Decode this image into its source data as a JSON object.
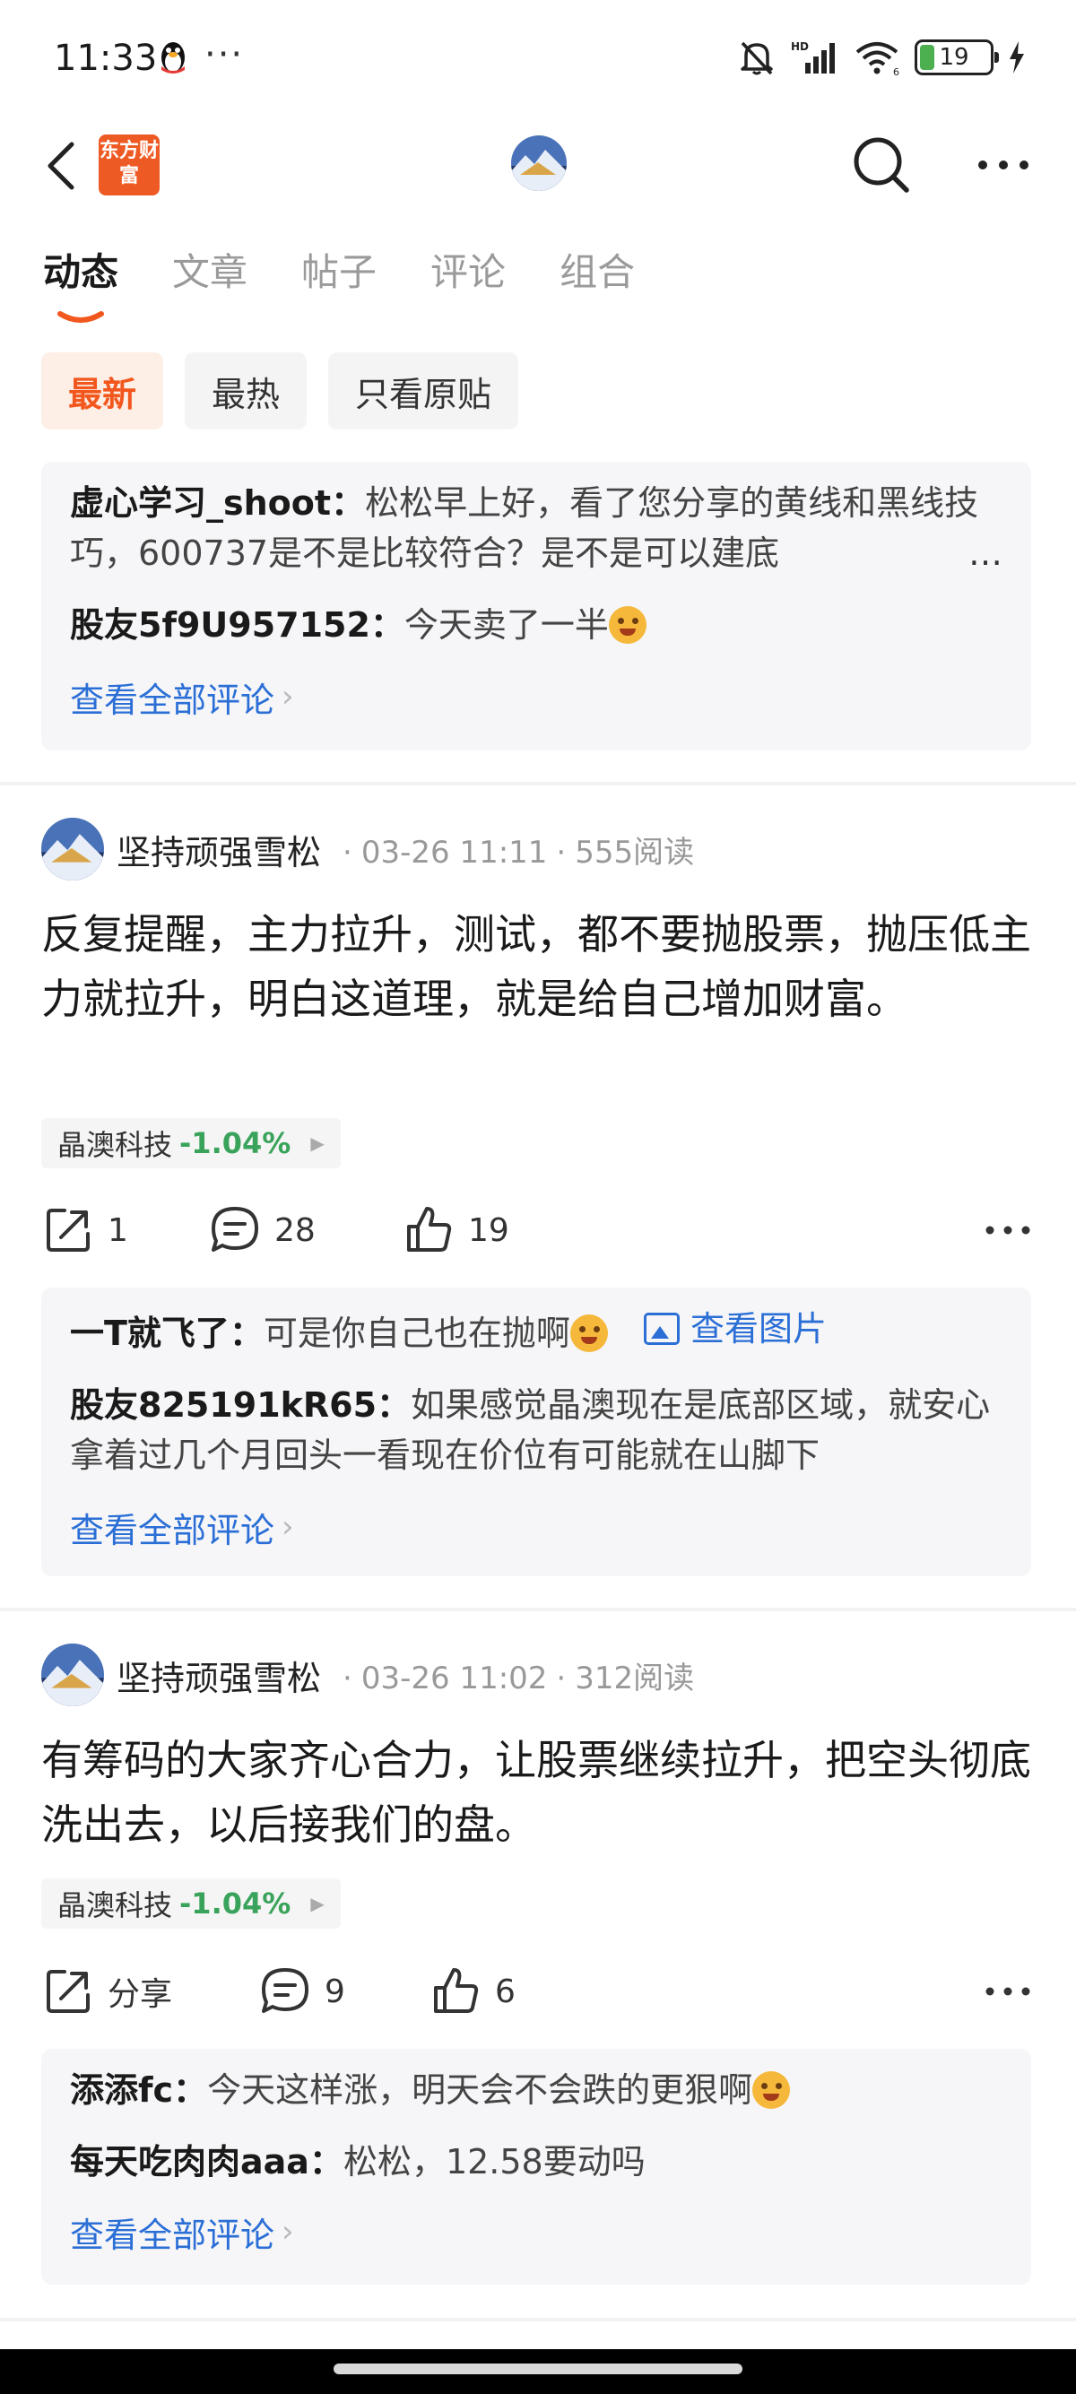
{
  "status_bar": {
    "time": "11:33",
    "dots": "···",
    "battery": "19"
  },
  "nav": {
    "logo_text": "东方财富"
  },
  "tabs": [
    "动态",
    "文章",
    "帖子",
    "评论",
    "组合"
  ],
  "filters": [
    "最新",
    "最热",
    "只看原贴"
  ],
  "top_comments": {
    "items": [
      {
        "author": "虚心学习_shoot：",
        "text": "松松早上好，看了您分享的黄线和黑线技巧，600737是不是比较符合？是不是可以建底"
      },
      {
        "author": "股友5f9U957152：",
        "text": "今天卖了一半"
      }
    ],
    "ellipsis": "…",
    "view_all": "查看全部评论"
  },
  "posts": [
    {
      "author": "坚持顽强雪松",
      "date": "03-26 11:11",
      "reads": "555阅读",
      "body": "反复提醒，主力拉升，测试，都不要抛股票，抛压低主力就拉升，明白这道理，就是给自己增加财富。",
      "stock": {
        "name": "晶澳科技",
        "change": "-1.04%"
      },
      "actions": {
        "share": "1",
        "comments": "28",
        "likes": "19"
      },
      "comments": [
        {
          "author": "一T就飞了：",
          "text": "可是你自己也在抛啊",
          "image_link": "查看图片"
        },
        {
          "author": "股友825191kR65：",
          "text": "如果感觉晶澳现在是底部区域，就安心拿着过几个月回头一看现在价位有可能就在山脚下"
        }
      ],
      "view_all": "查看全部评论"
    },
    {
      "author": "坚持顽强雪松",
      "date": "03-26 11:02",
      "reads": "312阅读",
      "body": "有筹码的大家齐心合力，让股票继续拉升，把空头彻底洗出去，以后接我们的盘。",
      "stock": {
        "name": "晶澳科技",
        "change": "-1.04%"
      },
      "actions": {
        "share": "分享",
        "comments": "9",
        "likes": "6"
      },
      "comments": [
        {
          "author": "添添fc：",
          "text": "今天这样涨，明天会不会跌的更狠啊"
        },
        {
          "author": "每天吃肉肉aaa：",
          "text": "松松，12.58要动吗"
        }
      ],
      "view_all": "查看全部评论"
    }
  ],
  "colors": {
    "accent": "#f2571d",
    "link": "#2b6fd6",
    "down": "#3aa35b"
  }
}
